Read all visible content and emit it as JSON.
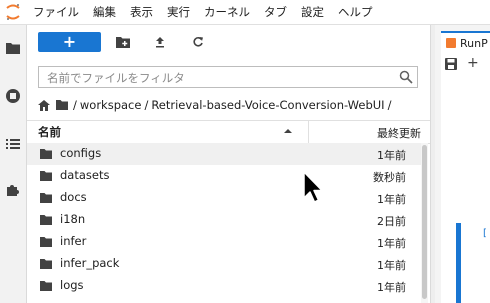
{
  "menubar": {
    "items": [
      "ファイル",
      "編集",
      "表示",
      "実行",
      "カーネル",
      "タブ",
      "設定",
      "ヘルプ"
    ]
  },
  "toolbar": {
    "new_label": "+"
  },
  "filter": {
    "placeholder": "名前でファイルをフィルタ"
  },
  "breadcrumb": {
    "segments": [
      "workspace",
      "Retrieval-based-Voice-Conversion-WebUI"
    ]
  },
  "list_header": {
    "name": "名前",
    "modified": "最終更新"
  },
  "files": [
    {
      "name": "configs",
      "modified": "1年前"
    },
    {
      "name": "datasets",
      "modified": "数秒前"
    },
    {
      "name": "docs",
      "modified": "1年前"
    },
    {
      "name": "i18n",
      "modified": "2日前"
    },
    {
      "name": "infer",
      "modified": "1年前"
    },
    {
      "name": "infer_pack",
      "modified": "1年前"
    },
    {
      "name": "logs",
      "modified": "1年前"
    }
  ],
  "editor": {
    "tab_label": "RunP"
  },
  "colors": {
    "accent": "#1976d2",
    "logo": "#f27b2f"
  }
}
